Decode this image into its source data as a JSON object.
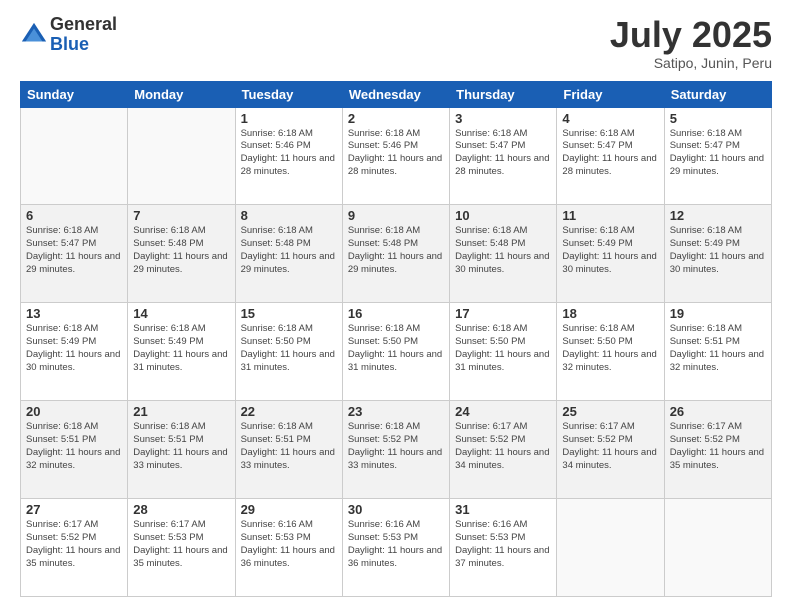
{
  "logo": {
    "general": "General",
    "blue": "Blue"
  },
  "header": {
    "month": "July 2025",
    "location": "Satipo, Junin, Peru"
  },
  "days_of_week": [
    "Sunday",
    "Monday",
    "Tuesday",
    "Wednesday",
    "Thursday",
    "Friday",
    "Saturday"
  ],
  "weeks": [
    [
      {
        "day": "",
        "info": ""
      },
      {
        "day": "",
        "info": ""
      },
      {
        "day": "1",
        "info": "Sunrise: 6:18 AM\nSunset: 5:46 PM\nDaylight: 11 hours and 28 minutes."
      },
      {
        "day": "2",
        "info": "Sunrise: 6:18 AM\nSunset: 5:46 PM\nDaylight: 11 hours and 28 minutes."
      },
      {
        "day": "3",
        "info": "Sunrise: 6:18 AM\nSunset: 5:47 PM\nDaylight: 11 hours and 28 minutes."
      },
      {
        "day": "4",
        "info": "Sunrise: 6:18 AM\nSunset: 5:47 PM\nDaylight: 11 hours and 28 minutes."
      },
      {
        "day": "5",
        "info": "Sunrise: 6:18 AM\nSunset: 5:47 PM\nDaylight: 11 hours and 29 minutes."
      }
    ],
    [
      {
        "day": "6",
        "info": "Sunrise: 6:18 AM\nSunset: 5:47 PM\nDaylight: 11 hours and 29 minutes."
      },
      {
        "day": "7",
        "info": "Sunrise: 6:18 AM\nSunset: 5:48 PM\nDaylight: 11 hours and 29 minutes."
      },
      {
        "day": "8",
        "info": "Sunrise: 6:18 AM\nSunset: 5:48 PM\nDaylight: 11 hours and 29 minutes."
      },
      {
        "day": "9",
        "info": "Sunrise: 6:18 AM\nSunset: 5:48 PM\nDaylight: 11 hours and 29 minutes."
      },
      {
        "day": "10",
        "info": "Sunrise: 6:18 AM\nSunset: 5:48 PM\nDaylight: 11 hours and 30 minutes."
      },
      {
        "day": "11",
        "info": "Sunrise: 6:18 AM\nSunset: 5:49 PM\nDaylight: 11 hours and 30 minutes."
      },
      {
        "day": "12",
        "info": "Sunrise: 6:18 AM\nSunset: 5:49 PM\nDaylight: 11 hours and 30 minutes."
      }
    ],
    [
      {
        "day": "13",
        "info": "Sunrise: 6:18 AM\nSunset: 5:49 PM\nDaylight: 11 hours and 30 minutes."
      },
      {
        "day": "14",
        "info": "Sunrise: 6:18 AM\nSunset: 5:49 PM\nDaylight: 11 hours and 31 minutes."
      },
      {
        "day": "15",
        "info": "Sunrise: 6:18 AM\nSunset: 5:50 PM\nDaylight: 11 hours and 31 minutes."
      },
      {
        "day": "16",
        "info": "Sunrise: 6:18 AM\nSunset: 5:50 PM\nDaylight: 11 hours and 31 minutes."
      },
      {
        "day": "17",
        "info": "Sunrise: 6:18 AM\nSunset: 5:50 PM\nDaylight: 11 hours and 31 minutes."
      },
      {
        "day": "18",
        "info": "Sunrise: 6:18 AM\nSunset: 5:50 PM\nDaylight: 11 hours and 32 minutes."
      },
      {
        "day": "19",
        "info": "Sunrise: 6:18 AM\nSunset: 5:51 PM\nDaylight: 11 hours and 32 minutes."
      }
    ],
    [
      {
        "day": "20",
        "info": "Sunrise: 6:18 AM\nSunset: 5:51 PM\nDaylight: 11 hours and 32 minutes."
      },
      {
        "day": "21",
        "info": "Sunrise: 6:18 AM\nSunset: 5:51 PM\nDaylight: 11 hours and 33 minutes."
      },
      {
        "day": "22",
        "info": "Sunrise: 6:18 AM\nSunset: 5:51 PM\nDaylight: 11 hours and 33 minutes."
      },
      {
        "day": "23",
        "info": "Sunrise: 6:18 AM\nSunset: 5:52 PM\nDaylight: 11 hours and 33 minutes."
      },
      {
        "day": "24",
        "info": "Sunrise: 6:17 AM\nSunset: 5:52 PM\nDaylight: 11 hours and 34 minutes."
      },
      {
        "day": "25",
        "info": "Sunrise: 6:17 AM\nSunset: 5:52 PM\nDaylight: 11 hours and 34 minutes."
      },
      {
        "day": "26",
        "info": "Sunrise: 6:17 AM\nSunset: 5:52 PM\nDaylight: 11 hours and 35 minutes."
      }
    ],
    [
      {
        "day": "27",
        "info": "Sunrise: 6:17 AM\nSunset: 5:52 PM\nDaylight: 11 hours and 35 minutes."
      },
      {
        "day": "28",
        "info": "Sunrise: 6:17 AM\nSunset: 5:53 PM\nDaylight: 11 hours and 35 minutes."
      },
      {
        "day": "29",
        "info": "Sunrise: 6:16 AM\nSunset: 5:53 PM\nDaylight: 11 hours and 36 minutes."
      },
      {
        "day": "30",
        "info": "Sunrise: 6:16 AM\nSunset: 5:53 PM\nDaylight: 11 hours and 36 minutes."
      },
      {
        "day": "31",
        "info": "Sunrise: 6:16 AM\nSunset: 5:53 PM\nDaylight: 11 hours and 37 minutes."
      },
      {
        "day": "",
        "info": ""
      },
      {
        "day": "",
        "info": ""
      }
    ]
  ]
}
